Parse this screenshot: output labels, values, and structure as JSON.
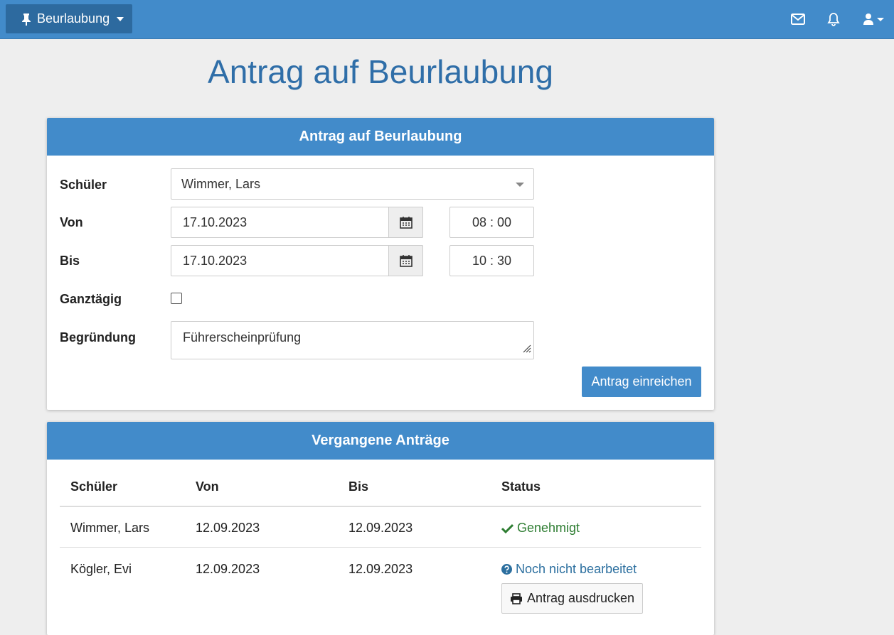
{
  "navbar": {
    "brand_label": "Beurlaubung",
    "icons": [
      "pin-icon",
      "mail-icon",
      "bell-icon",
      "user-icon"
    ]
  },
  "page": {
    "title": "Antrag auf Beurlaubung"
  },
  "form_panel": {
    "heading": "Antrag auf Beurlaubung",
    "student_label": "Schüler",
    "student_value": "Wimmer, Lars",
    "from_label": "Von",
    "from_date": "17.10.2023",
    "from_time": "08 : 00",
    "to_label": "Bis",
    "to_date": "17.10.2023",
    "to_time": "10 : 30",
    "allday_label": "Ganztägig",
    "allday_checked": false,
    "reason_label": "Begründung",
    "reason_value": "Führerscheinprüfung",
    "submit_label": "Antrag einreichen"
  },
  "history_panel": {
    "heading": "Vergangene Anträge",
    "columns": [
      "Schüler",
      "Von",
      "Bis",
      "Status"
    ],
    "rows": [
      {
        "student": "Wimmer, Lars",
        "from": "12.09.2023",
        "to": "12.09.2023",
        "status": "Genehmigt"
      },
      {
        "student": "Kögler, Evi",
        "from": "12.09.2023",
        "to": "12.09.2023",
        "status": "Noch nicht bearbeitet",
        "action": "Antrag ausdrucken"
      }
    ]
  },
  "colors": {
    "primary": "#428bca",
    "brand_dark": "#2d6a9f",
    "title": "#2f6ea8",
    "approved": "#2e7d32",
    "pending": "#2c6f9f"
  }
}
